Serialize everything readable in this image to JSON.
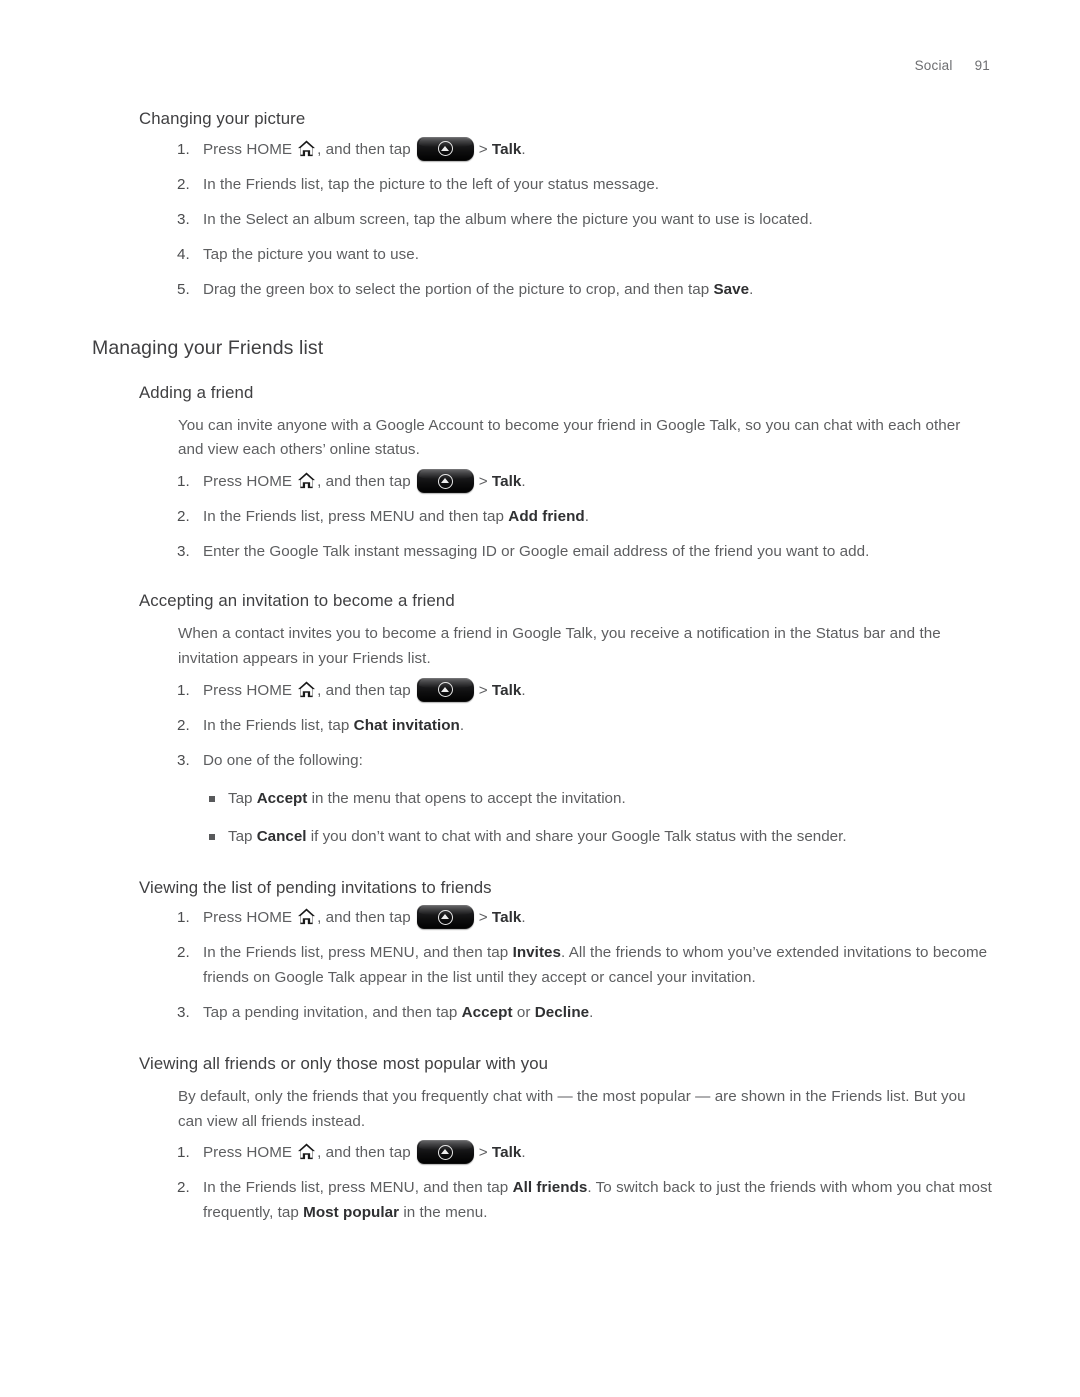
{
  "header": {
    "chapter": "Social",
    "page_number": "91"
  },
  "sections": [
    {
      "id": "changing-your-picture",
      "kind": "sub",
      "heading": "Changing your picture",
      "steps": [
        {
          "n": "1.",
          "type": "home-talk",
          "pre": "Press HOME",
          "mid": ", and then tap",
          "sep": ">",
          "bold": "Talk",
          "post": "."
        },
        {
          "n": "2.",
          "type": "plain",
          "text": "In the Friends list, tap the picture to the left of your status message."
        },
        {
          "n": "3.",
          "type": "plain",
          "text": "In the Select an album screen, tap the album where the picture you want to use is located."
        },
        {
          "n": "4.",
          "type": "plain",
          "text": "Tap the picture you want to use."
        },
        {
          "n": "5.",
          "type": "rich",
          "pre": "Drag the green box to select the portion of the picture to crop, and then tap ",
          "bold": "Save",
          "post": "."
        }
      ]
    },
    {
      "id": "managing-your-friends-list",
      "kind": "section",
      "heading": "Managing your Friends list"
    },
    {
      "id": "adding-a-friend",
      "kind": "sub",
      "heading": "Adding a friend",
      "paragraph": "You can invite anyone with a Google Account to become your friend in Google Talk, so you can chat with each other and view each others’ online status.",
      "steps": [
        {
          "n": "1.",
          "type": "home-talk",
          "pre": "Press HOME",
          "mid": ", and then tap",
          "sep": ">",
          "bold": "Talk",
          "post": "."
        },
        {
          "n": "2.",
          "type": "rich",
          "pre": "In the Friends list, press MENU and then tap ",
          "bold": "Add friend",
          "post": "."
        },
        {
          "n": "3.",
          "type": "plain",
          "text": "Enter the Google Talk instant messaging ID or Google email address of the friend you want to add."
        }
      ]
    },
    {
      "id": "accepting-an-invitation",
      "kind": "sub",
      "heading": "Accepting an invitation to become a friend",
      "paragraph": "When a contact invites you to become a friend in Google Talk, you receive a notification in the Status bar and the invitation appears in your Friends list.",
      "steps": [
        {
          "n": "1.",
          "type": "home-talk",
          "pre": "Press HOME",
          "mid": ", and then tap",
          "sep": ">",
          "bold": "Talk",
          "post": "."
        },
        {
          "n": "2.",
          "type": "rich",
          "pre": "In the Friends list, tap ",
          "bold": "Chat invitation",
          "post": "."
        },
        {
          "n": "3.",
          "type": "plain",
          "text": "Do one of the following:",
          "bullets": [
            {
              "pre": "Tap ",
              "bold": "Accept",
              "post": " in the menu that opens to accept the invitation."
            },
            {
              "pre": "Tap ",
              "bold": "Cancel",
              "post": " if you don’t want to chat with and share your Google Talk status with the sender."
            }
          ]
        }
      ]
    },
    {
      "id": "viewing-pending-invitations",
      "kind": "sub",
      "heading": "Viewing the list of pending invitations to friends",
      "steps": [
        {
          "n": "1.",
          "type": "home-talk",
          "pre": "Press HOME",
          "mid": ", and then tap",
          "sep": ">",
          "bold": "Talk",
          "post": "."
        },
        {
          "n": "2.",
          "type": "rich",
          "pre": "In the Friends list, press MENU, and then tap ",
          "bold": "Invites",
          "post": ". All the friends to whom you’ve extended invitations to become friends on Google Talk appear in the list until they accept or cancel your invitation."
        },
        {
          "n": "3.",
          "type": "rich2",
          "pre": "Tap a pending invitation, and then tap ",
          "bold": "Accept",
          "mid": " or ",
          "bold2": "Decline",
          "post": "."
        }
      ]
    },
    {
      "id": "viewing-all-friends",
      "kind": "sub",
      "heading": "Viewing all friends or only those most popular with you",
      "paragraph": "By default, only the friends that you frequently chat with — the most popular — are shown in the Friends list. But you can view all friends instead.",
      "steps": [
        {
          "n": "1.",
          "type": "home-talk",
          "pre": "Press HOME",
          "mid": ", and then tap",
          "sep": ">",
          "bold": "Talk",
          "post": "."
        },
        {
          "n": "2.",
          "type": "rich2",
          "pre": "In the Friends list, press MENU, and then tap ",
          "bold": "All friends",
          "mid": ". To switch back to just the friends with whom you chat most frequently, tap ",
          "bold2": "Most popular",
          "post": " in the menu."
        }
      ]
    }
  ],
  "icons": {
    "home": "home-key-icon",
    "launcher": "app-launcher-button-icon"
  },
  "colors": {
    "body_text": "#5d5e60",
    "heading_text": "#404042",
    "bold_text": "#2f3032",
    "header_text": "#6d6e71",
    "page_background": "#ffffff"
  }
}
